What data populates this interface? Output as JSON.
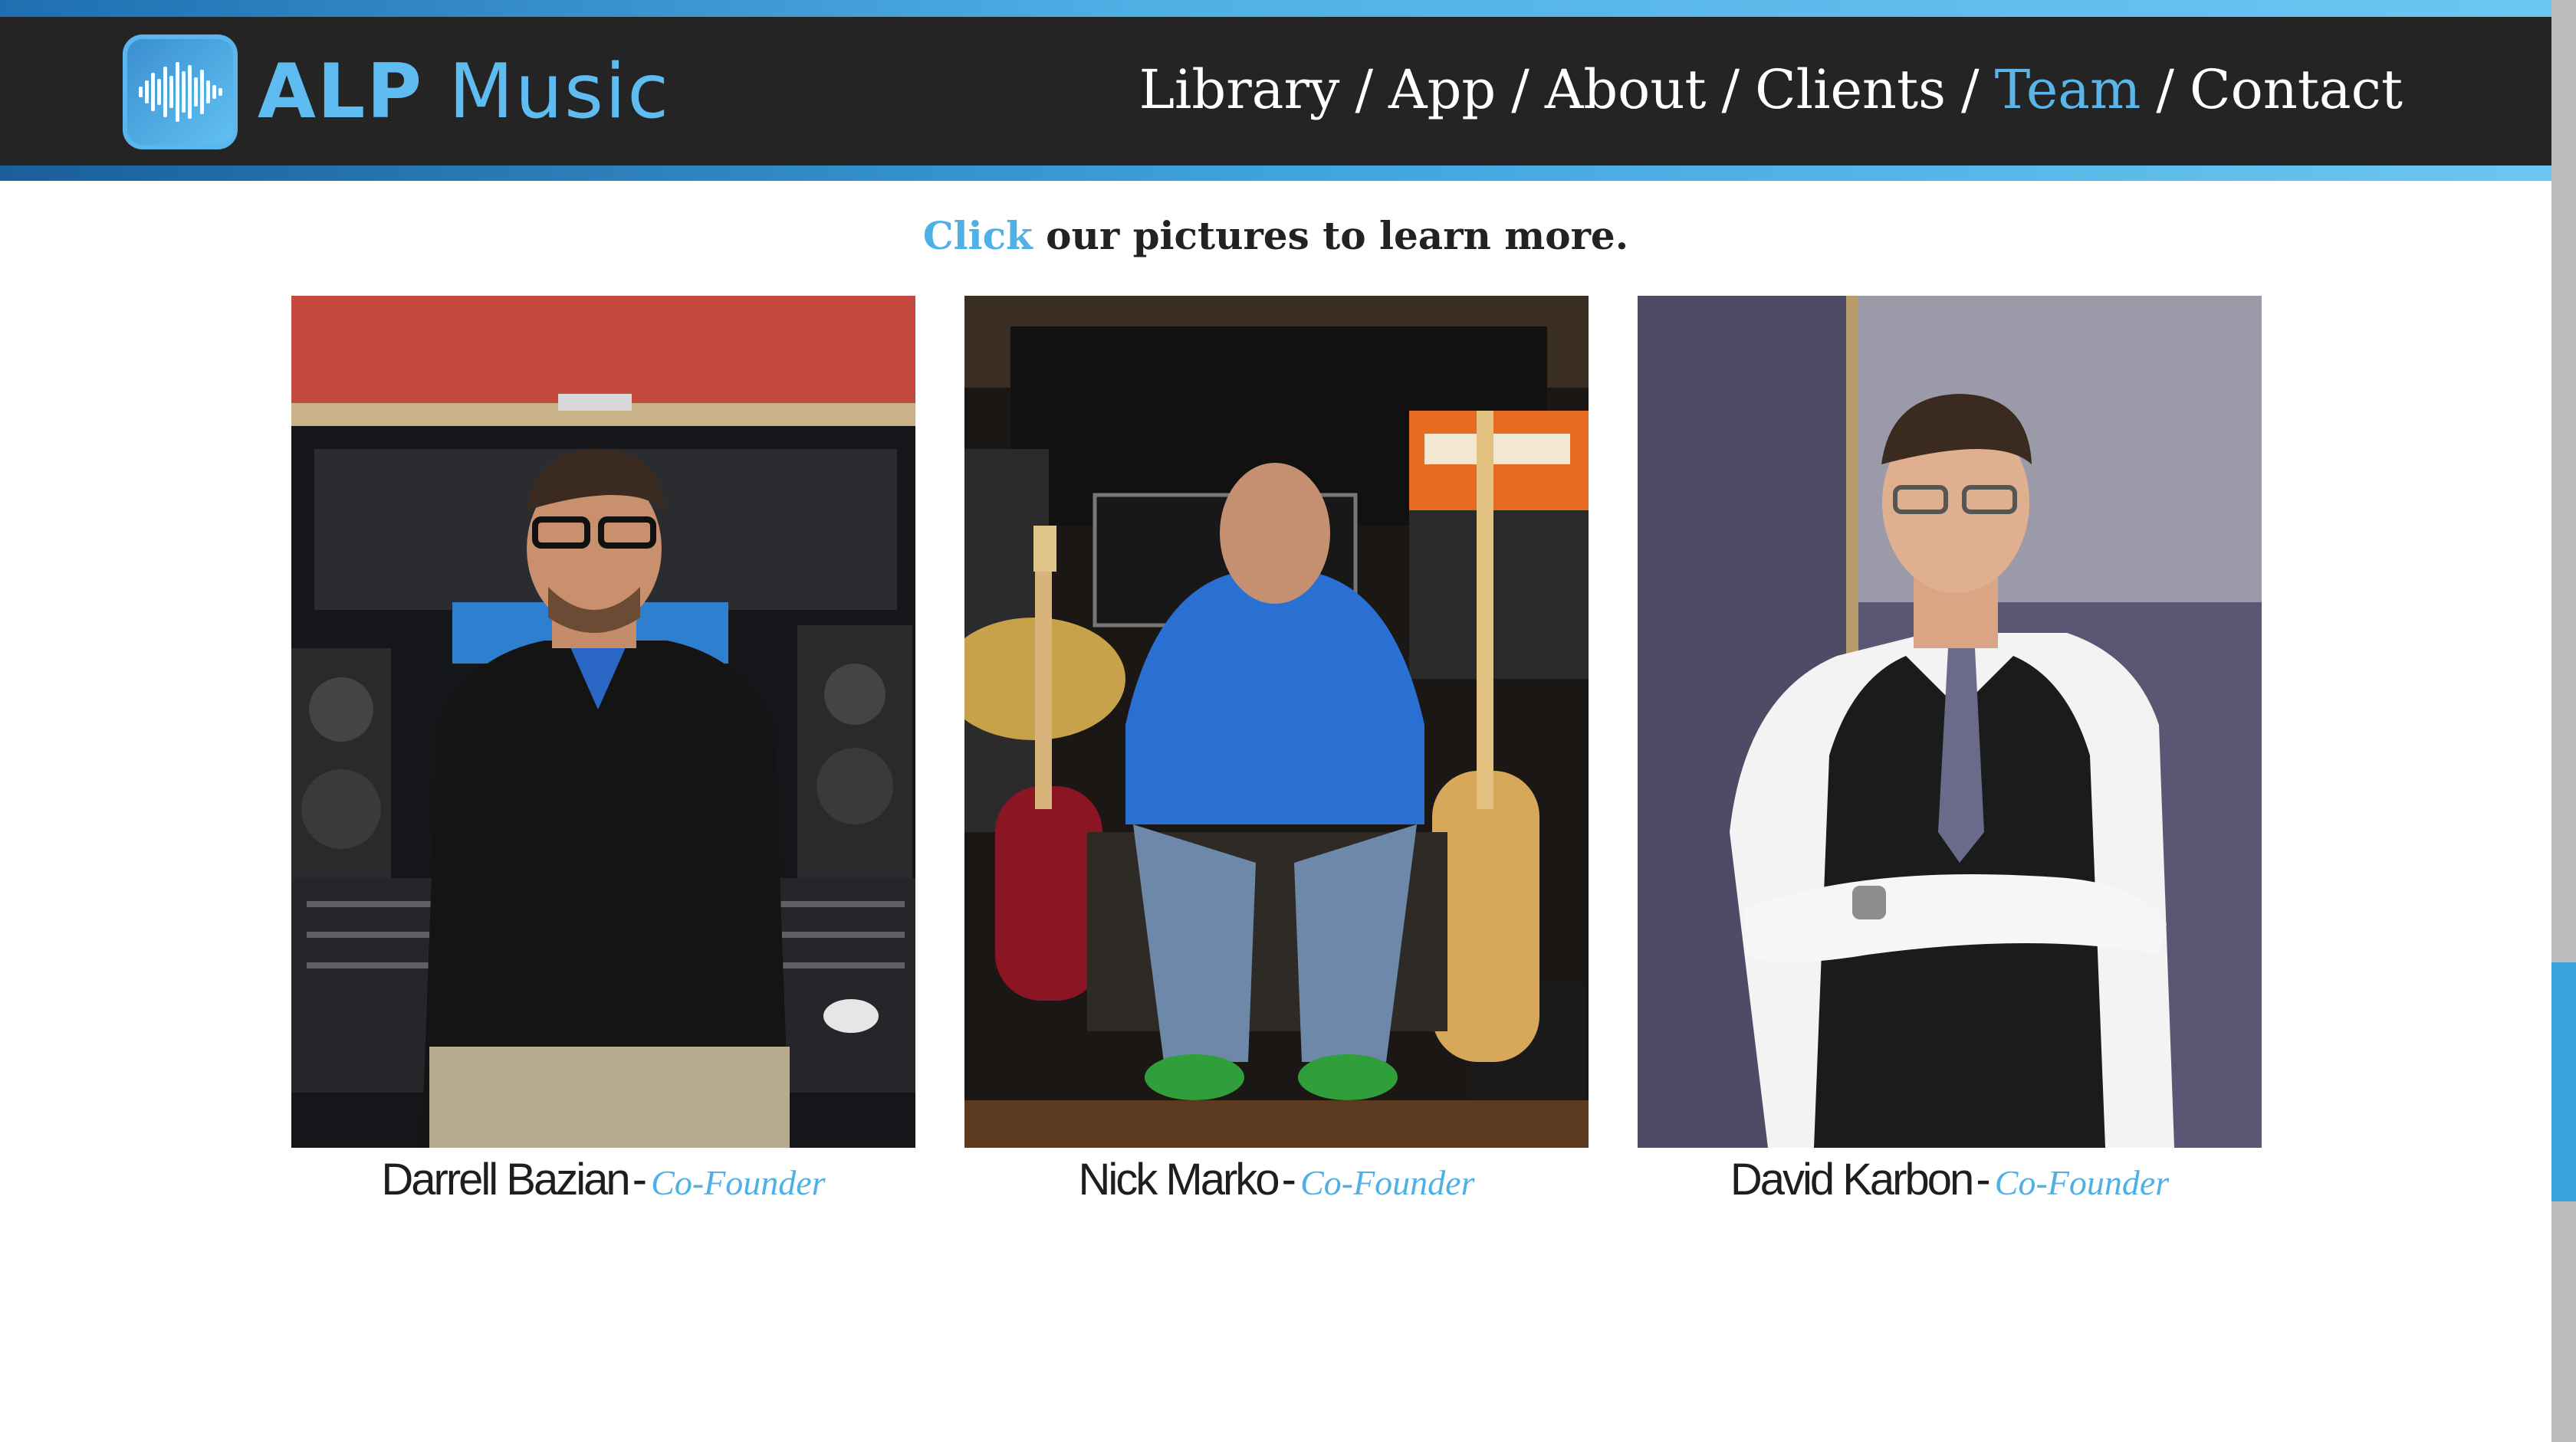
{
  "brand": {
    "name_bold": "ALP",
    "name_regular": "Music",
    "accent_color": "#5fbcf0"
  },
  "nav": {
    "items": [
      {
        "label": "Library",
        "active": false
      },
      {
        "label": "App",
        "active": false
      },
      {
        "label": "About",
        "active": false
      },
      {
        "label": "Clients",
        "active": false
      },
      {
        "label": "Team",
        "active": true
      },
      {
        "label": "Contact",
        "active": false
      }
    ],
    "separator": "/"
  },
  "intro": {
    "click_word": "Click",
    "rest": "our pictures to learn more."
  },
  "team": [
    {
      "name": "Darrell Bazian",
      "role": "Co-Founder",
      "photo_icon": "portrait-studio-console"
    },
    {
      "name": "Nick Marko",
      "role": "Co-Founder",
      "photo_icon": "portrait-guitars-amps"
    },
    {
      "name": "David Karbon",
      "role": "Co-Founder",
      "photo_icon": "portrait-suit-arms-crossed"
    }
  ],
  "caption_dash": "-"
}
